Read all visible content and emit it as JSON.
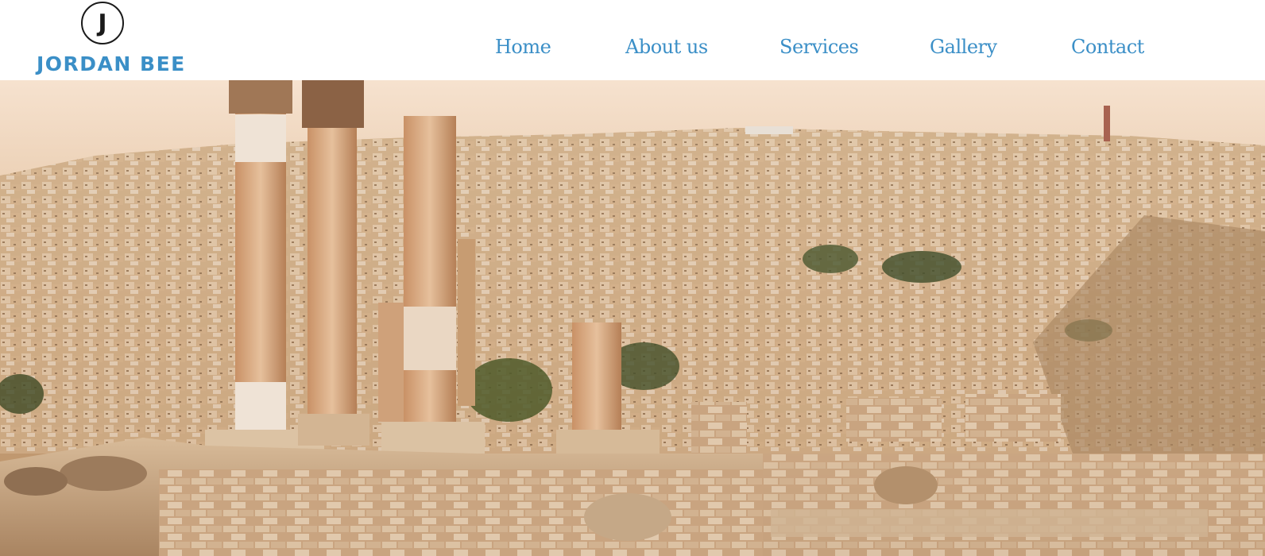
{
  "brand": {
    "logo_letter": "J",
    "name": "JORDAN BEE",
    "accent_color": "#3b8fc7"
  },
  "nav": {
    "items": [
      {
        "label": "Home"
      },
      {
        "label": "About us"
      },
      {
        "label": "Services"
      },
      {
        "label": "Gallery"
      },
      {
        "label": "Contact"
      }
    ]
  },
  "hero": {
    "image_subject": "city-skyline-with-ancient-columns"
  }
}
